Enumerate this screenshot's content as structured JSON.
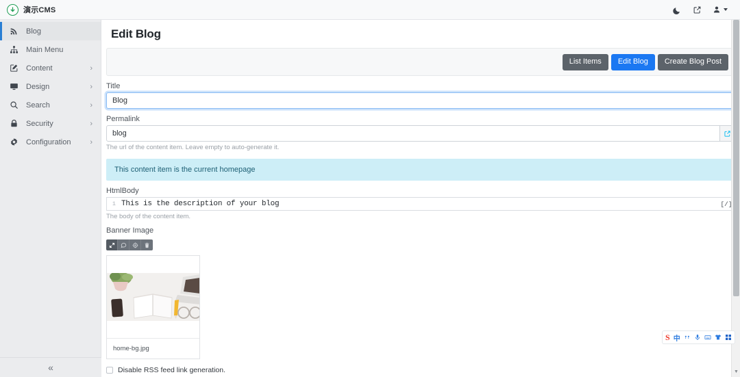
{
  "topbar": {
    "brand_name": "演示CMS",
    "logo_icon": "green-circle-arrow-logo",
    "dark_mode_icon": "moon-icon",
    "external_link_icon": "external-link-icon",
    "user_icon": "user-icon",
    "user_caret_icon": "chevron-down-icon"
  },
  "sidebar": {
    "items": [
      {
        "label": "Blog",
        "icon": "rss-icon",
        "active": true,
        "chevron": ""
      },
      {
        "label": "Main Menu",
        "icon": "sitemap-icon",
        "active": false,
        "chevron": ""
      },
      {
        "label": "Content",
        "icon": "pencil-square-icon",
        "active": false,
        "chevron": "›"
      },
      {
        "label": "Design",
        "icon": "monitor-icon",
        "active": false,
        "chevron": "›"
      },
      {
        "label": "Search",
        "icon": "magnifier-icon",
        "active": false,
        "chevron": "›"
      },
      {
        "label": "Security",
        "icon": "padlock-icon",
        "active": false,
        "chevron": "›"
      },
      {
        "label": "Configuration",
        "icon": "gear-icon",
        "active": false,
        "chevron": "›"
      }
    ],
    "collapse_label": "«"
  },
  "main": {
    "page_title": "Edit Blog",
    "actions": [
      {
        "label": "List Items",
        "style": "secondary"
      },
      {
        "label": "Edit Blog",
        "style": "primary"
      },
      {
        "label": "Create Blog Post",
        "style": "secondary"
      }
    ],
    "title_field": {
      "label": "Title",
      "value": "Blog",
      "placeholder": ""
    },
    "permalink_field": {
      "label": "Permalink",
      "value": "blog",
      "placeholder": "",
      "help": "The url of the content item. Leave empty to auto-generate it.",
      "addon_icon": "external-link-icon"
    },
    "homepage_alert": "This content item is the current homepage",
    "htmlbody_field": {
      "label": "HtmlBody",
      "line_number": "1",
      "value": "This is the description of your blog",
      "help": "The body of the content item.",
      "toggle_label": "[/]"
    },
    "banner_image": {
      "label": "Banner Image",
      "toolbar": [
        {
          "icon": "expand-arrows-icon",
          "active": true
        },
        {
          "icon": "comment-icon",
          "active": false
        },
        {
          "icon": "settings-icon",
          "active": false
        },
        {
          "icon": "trash-icon",
          "active": false
        }
      ],
      "file_name": "home-bg.jpg",
      "thumbnail_alt": "desk-photo-notebook-phone-laptop"
    },
    "rss_checkbox": {
      "label": "Disable RSS feed link generation.",
      "checked": false
    }
  },
  "scrollbar": {
    "down_arrow_icon": "triangle-down-icon"
  },
  "ime": {
    "items": [
      {
        "icon": "sogou-s-logo",
        "label": "S"
      },
      {
        "icon": "chinese-mode",
        "label": "中"
      },
      {
        "icon": "punctuation-icon",
        "label": ""
      },
      {
        "icon": "microphone-icon",
        "label": ""
      },
      {
        "icon": "keyboard-icon",
        "label": ""
      },
      {
        "icon": "skin-shirt-icon",
        "label": ""
      },
      {
        "icon": "apps-grid-icon",
        "label": ""
      }
    ]
  },
  "colors": {
    "accent": "#1b78f2",
    "sidebar_bg": "#ebecee",
    "alert_bg": "#cdeef7",
    "alert_text": "#1d5f74",
    "button_secondary": "#5c636a",
    "addon_icon": "#29c3f0"
  }
}
